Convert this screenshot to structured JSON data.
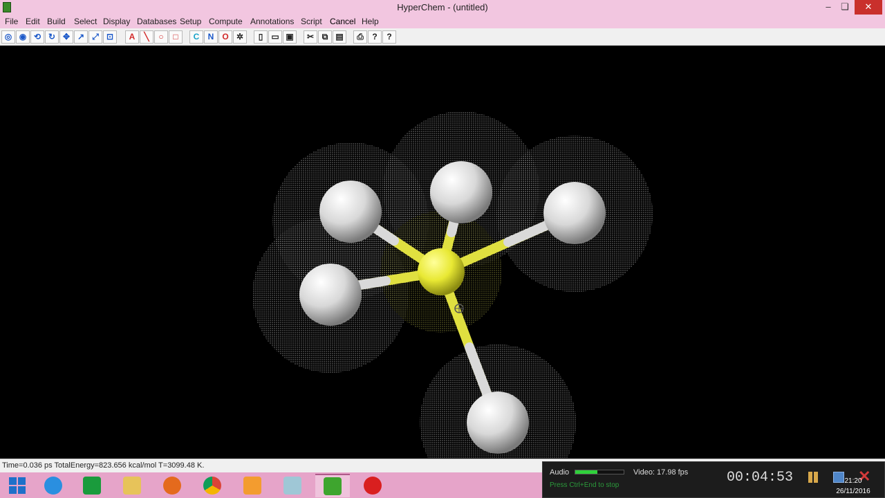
{
  "window": {
    "title": "HyperChem - (untitled)",
    "minimize": "–",
    "maximize": "❏",
    "close": "✕"
  },
  "menu": [
    "File",
    "Edit",
    "Build",
    "Select",
    "Display",
    "Databases",
    "Setup",
    "Compute",
    "Annotations",
    "Script",
    "Cancel",
    "Help"
  ],
  "toolbar": {
    "element_buttons": [
      "A",
      "C",
      "N",
      "O"
    ],
    "help_labels": [
      "?",
      "?"
    ]
  },
  "status": {
    "text": "Time=0.036 ps  TotalEnergy=823.656 kcal/mol   T=3099.48 K."
  },
  "recorder": {
    "audio_label": "Audio",
    "audio_level": 0.45,
    "video_label": "Video: 17.98 fps",
    "hint": "Press Ctrl+End to stop",
    "elapsed": "00:04:53"
  },
  "clock": {
    "time": "21:20",
    "date": "26/11/2016"
  },
  "colors": {
    "titlebar": "#f2c6e0",
    "taskbar": "#e6a4c9",
    "silicon": "#e8e833",
    "hydrogen": "#ffffff"
  }
}
